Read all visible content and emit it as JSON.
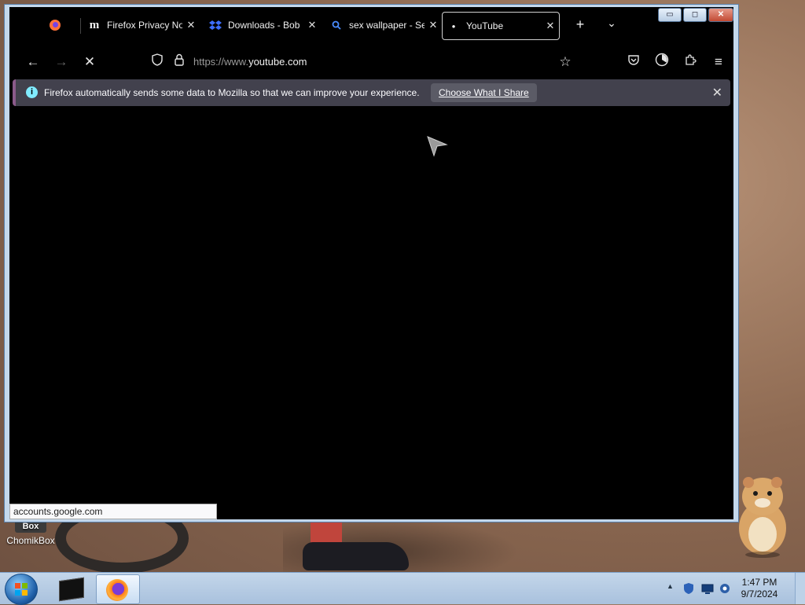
{
  "window": {
    "controls": {
      "minimize": "▭",
      "maximize": "◻",
      "close": "✕"
    }
  },
  "tabs": [
    {
      "label": "",
      "icon": "firefox-icon",
      "active": false
    },
    {
      "label": "Firefox Privacy Notice",
      "icon": "mozilla-m-icon",
      "active": false
    },
    {
      "label": "Downloads - Bob",
      "icon": "dropbox-icon",
      "active": false
    },
    {
      "label": "sex wallpaper - Search",
      "icon": "search-icon",
      "active": false
    },
    {
      "label": "YouTube",
      "icon": "loading-dot-icon",
      "active": true
    }
  ],
  "tabbar": {
    "new_tab": "+",
    "list_all": "⌄"
  },
  "navbar": {
    "url_prefix": "https://www.",
    "url_domain": "youtube.com"
  },
  "infobar": {
    "message": "Firefox automatically sends some data to Mozilla so that we can improve your experience.",
    "button": "Choose What I Share"
  },
  "status": {
    "text": "accounts.google.com"
  },
  "desktop": {
    "icon_badge": "Box",
    "icon_label": "ChomikBox"
  },
  "taskbar": {
    "time": "1:47 PM",
    "date": "9/7/2024"
  },
  "colors": {
    "infobar_bg": "#42414d",
    "info_icon": "#80ebff",
    "browser_bg": "#000000"
  }
}
